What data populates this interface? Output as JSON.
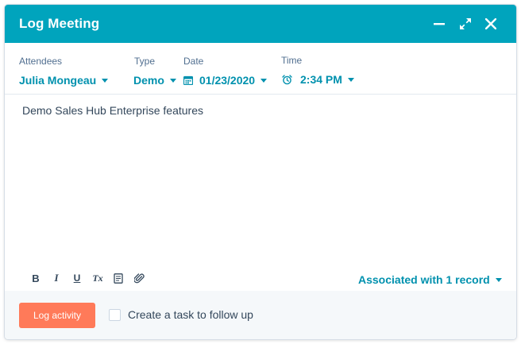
{
  "header": {
    "title": "Log Meeting",
    "minimize_icon": "minus-icon",
    "expand_icon": "expand-arrows-icon",
    "close_icon": "close-icon",
    "bg_color": "#00a4bd"
  },
  "fields": {
    "attendees": {
      "label": "Attendees",
      "value": "Julia Mongeau"
    },
    "type": {
      "label": "Type",
      "value": "Demo"
    },
    "date": {
      "label": "Date",
      "value": "01/23/2020",
      "icon": "calendar-icon"
    },
    "time": {
      "label": "Time",
      "value": "2:34 PM",
      "icon": "alarm-clock-icon"
    }
  },
  "note": {
    "text": "Demo Sales Hub Enterprise features"
  },
  "toolbar": {
    "items": [
      {
        "name": "bold",
        "icon": "bold-icon",
        "glyph": "B"
      },
      {
        "name": "italic",
        "icon": "italic-icon",
        "glyph": "I"
      },
      {
        "name": "underline",
        "icon": "underline-icon",
        "glyph": "U"
      },
      {
        "name": "clear-format",
        "icon": "clear-format-icon",
        "glyph": "Tx"
      },
      {
        "name": "snippet",
        "icon": "snippet-icon"
      },
      {
        "name": "attach",
        "icon": "paperclip-icon"
      }
    ]
  },
  "association": {
    "label": "Associated with 1 record"
  },
  "footer": {
    "log_button": "Log activity",
    "task_checkbox_label": "Create a task to follow up",
    "task_checked": false,
    "accent_color": "#ff7a59"
  },
  "colors": {
    "link": "#0091ae",
    "text": "#33475b",
    "label": "#516f90"
  }
}
